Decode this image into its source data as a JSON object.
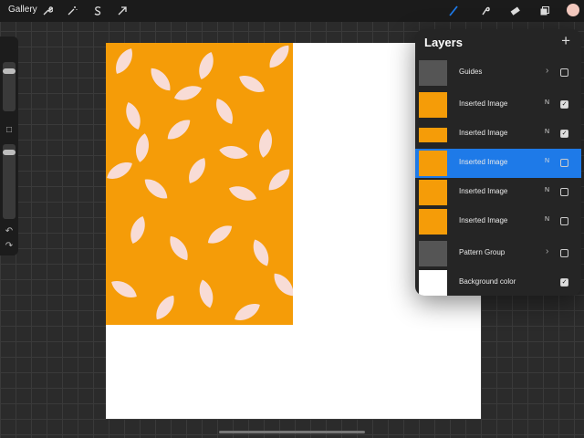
{
  "toolbar": {
    "gallery_label": "Gallery",
    "tools_left": [
      "wrench-icon",
      "magic-wand-icon",
      "selection-s-icon",
      "transform-arrow-icon"
    ],
    "tools_right": [
      "brush-icon",
      "smudge-icon",
      "eraser-icon",
      "layers-icon"
    ],
    "accent": "#1e7ae8"
  },
  "canvas": {
    "pattern_color": "#f59c08",
    "leaf_color": "#f8dcd6",
    "background": "#ffffff"
  },
  "layers_panel": {
    "title": "Layers",
    "add_label": "+",
    "layers": [
      {
        "name": "Guides",
        "blend": "",
        "chevron": "›",
        "checked": false,
        "selected": false
      },
      {
        "name": "Inserted Image",
        "blend": "N",
        "chevron": "",
        "checked": true,
        "selected": false
      },
      {
        "name": "Inserted Image",
        "blend": "N",
        "chevron": "",
        "checked": true,
        "selected": false
      },
      {
        "name": "Inserted Image",
        "blend": "N",
        "chevron": "",
        "checked": false,
        "selected": true
      },
      {
        "name": "Inserted Image",
        "blend": "N",
        "chevron": "",
        "checked": false,
        "selected": false
      },
      {
        "name": "Inserted Image",
        "blend": "N",
        "chevron": "",
        "checked": false,
        "selected": false
      },
      {
        "name": "Pattern Group",
        "blend": "",
        "chevron": "›",
        "checked": false,
        "selected": false
      },
      {
        "name": "Background color",
        "blend": "",
        "chevron": "",
        "checked": true,
        "selected": false
      }
    ]
  },
  "sidebar": {
    "undo_icon": "↶",
    "redo_icon": "↷",
    "modify_icon": "□"
  }
}
